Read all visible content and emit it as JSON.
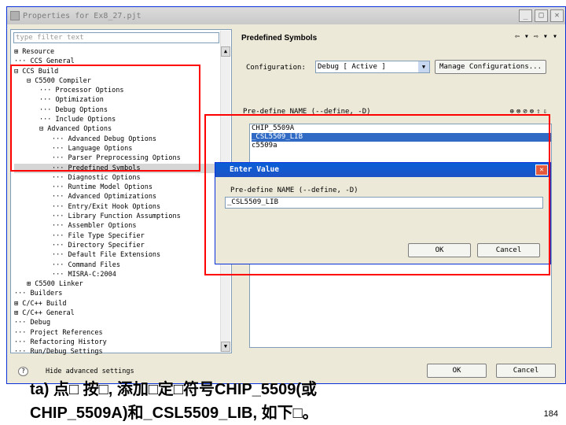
{
  "window": {
    "title": "Properties for Ex8_27.pjt",
    "min_glyph": "_",
    "max_glyph": "□",
    "close_glyph": "✕"
  },
  "filter_placeholder": "type filter text",
  "tree": [
    {
      "text": "⊞ Resource",
      "indent": 0
    },
    {
      "text": "··· CCS General",
      "indent": 0
    },
    {
      "text": "⊟ CCS Build",
      "indent": 0
    },
    {
      "text": "⊟ C5500 Compiler",
      "indent": 1
    },
    {
      "text": "··· Processor Options",
      "indent": 2
    },
    {
      "text": "··· Optimization",
      "indent": 2
    },
    {
      "text": "··· Debug Options",
      "indent": 2
    },
    {
      "text": "··· Include Options",
      "indent": 2
    },
    {
      "text": "⊟ Advanced Options",
      "indent": 2
    },
    {
      "text": "··· Advanced Debug Options",
      "indent": 3
    },
    {
      "text": "··· Language Options",
      "indent": 3
    },
    {
      "text": "··· Parser Preprocessing Options",
      "indent": 3
    },
    {
      "text": "··· Predefined Symbols",
      "indent": 3,
      "selected": true
    },
    {
      "text": "··· Diagnostic Options",
      "indent": 3
    },
    {
      "text": "··· Runtime Model Options",
      "indent": 3
    },
    {
      "text": "··· Advanced Optimizations",
      "indent": 3
    },
    {
      "text": "··· Entry/Exit Hook Options",
      "indent": 3
    },
    {
      "text": "··· Library Function Assumptions",
      "indent": 3
    },
    {
      "text": "··· Assembler Options",
      "indent": 3
    },
    {
      "text": "··· File Type Specifier",
      "indent": 3
    },
    {
      "text": "··· Directory Specifier",
      "indent": 3
    },
    {
      "text": "··· Default File Extensions",
      "indent": 3
    },
    {
      "text": "··· Command Files",
      "indent": 3
    },
    {
      "text": "··· MISRA-C:2004",
      "indent": 3
    },
    {
      "text": "⊞ C5500 Linker",
      "indent": 1
    },
    {
      "text": "··· Builders",
      "indent": 0
    },
    {
      "text": "⊞ C/C++ Build",
      "indent": 0
    },
    {
      "text": "⊞ C/C++ General",
      "indent": 0
    },
    {
      "text": "··· Debug",
      "indent": 0
    },
    {
      "text": "··· Project References",
      "indent": 0
    },
    {
      "text": "··· Refactoring History",
      "indent": 0
    },
    {
      "text": "··· Run/Debug Settings",
      "indent": 0
    }
  ],
  "panel": {
    "header": "Predefined Symbols",
    "nav": "⇦ ▾ ⇨ ▾ ▾",
    "config_label": "Configuration:",
    "config_value": "Debug  [ Active ]",
    "manage_button": "Manage Configurations...",
    "symbols_label": "Pre-define NAME (--define, -D)",
    "tools": "⊕⊗⊘⊚⇧⇩",
    "symbols": [
      "CHIP_5509A",
      "_CSL5509_LIB",
      "c5509a"
    ],
    "selected_index": 1
  },
  "dialog": {
    "title": "Enter Value",
    "close_glyph": "✕",
    "label": "Pre-define NAME (--define, -D)",
    "value": "_CSL5509_LIB",
    "ok": "OK",
    "cancel": "Cancel"
  },
  "bottom": {
    "hint_glyph": "?",
    "hide_text": "Hide advanced settings",
    "ok": "OK",
    "cancel": "Cancel"
  },
  "caption": {
    "line1": "ta) 点□    按□, 添加□定□符号CHIP_5509(或",
    "line2": "CHIP_5509A)和_CSL5509_LIB, 如下□。"
  },
  "page_number": "184",
  "colors": {
    "highlight": "#316ac5",
    "annotation_box": "#ff0000"
  }
}
